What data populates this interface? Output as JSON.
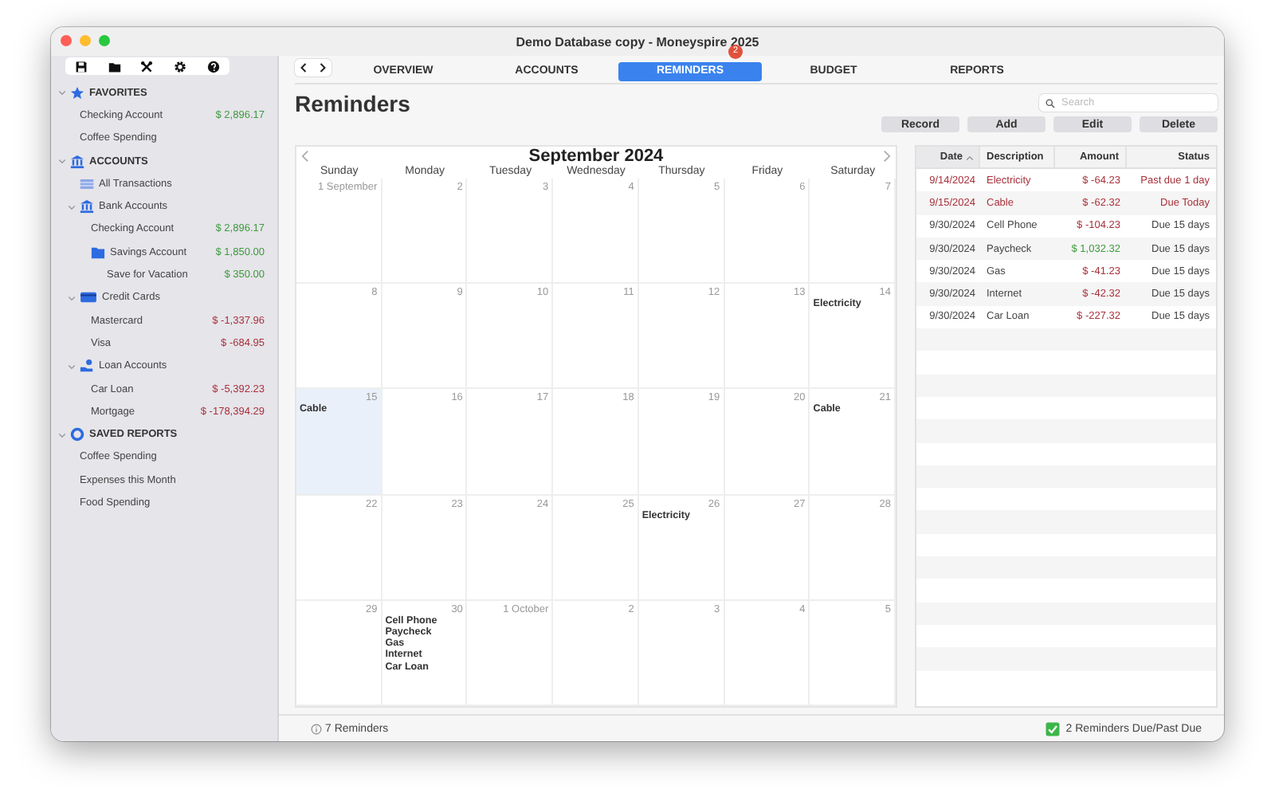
{
  "window": {
    "title": "Demo Database copy - Moneyspire 2025"
  },
  "sidebar": {
    "sections": [
      {
        "title": "FAVORITES",
        "kind": "favorites",
        "expanded": true,
        "items": [
          {
            "label": "Checking Account",
            "amount": "$ 2,896.17",
            "negative": false
          },
          {
            "label": "Coffee Spending"
          }
        ]
      },
      {
        "title": "ACCOUNTS",
        "kind": "accounts",
        "expanded": true,
        "items": [
          {
            "label": "All Transactions",
            "kind": "list"
          },
          {
            "label": "Bank Accounts",
            "kind": "bank",
            "expanded": true,
            "children": [
              {
                "label": "Checking Account",
                "amount": "$ 2,896.17",
                "negative": false
              },
              {
                "label": "Savings Account",
                "kind": "folder",
                "amount": "$ 1,850.00",
                "negative": false,
                "children": [
                  {
                    "label": "Save for Vacation",
                    "amount": "$ 350.00",
                    "negative": false
                  }
                ]
              }
            ]
          },
          {
            "label": "Credit Cards",
            "kind": "card",
            "expanded": true,
            "children": [
              {
                "label": "Mastercard",
                "amount": "$ -1,337.96",
                "negative": true
              },
              {
                "label": "Visa",
                "amount": "$ -684.95",
                "negative": true
              }
            ]
          },
          {
            "label": "Loan Accounts",
            "kind": "loan",
            "expanded": true,
            "children": [
              {
                "label": "Car Loan",
                "amount": "$ -5,392.23",
                "negative": true
              },
              {
                "label": "Mortgage",
                "amount": "$ -178,394.29",
                "negative": true
              }
            ]
          }
        ]
      },
      {
        "title": "SAVED REPORTS",
        "kind": "reports",
        "expanded": true,
        "items": [
          {
            "label": "Coffee Spending"
          },
          {
            "label": "Expenses this Month"
          },
          {
            "label": "Food Spending"
          }
        ]
      }
    ]
  },
  "tabs": [
    {
      "label": "OVERVIEW",
      "selected": false
    },
    {
      "label": "ACCOUNTS",
      "selected": false
    },
    {
      "label": "REMINDERS",
      "selected": true,
      "badge": "2"
    },
    {
      "label": "BUDGET",
      "selected": false
    },
    {
      "label": "REPORTS",
      "selected": false
    }
  ],
  "page_title": "Reminders",
  "search": {
    "placeholder": "Search"
  },
  "buttons": [
    "Record",
    "Add",
    "Edit",
    "Delete"
  ],
  "calendar": {
    "title": "September 2024",
    "weekdays": [
      "Sunday",
      "Monday",
      "Tuesday",
      "Wednesday",
      "Thursday",
      "Friday",
      "Saturday"
    ],
    "weeks": [
      [
        {
          "day": "1 September",
          "selected": false
        },
        {
          "day": "2",
          "selected": false
        },
        {
          "day": "3",
          "selected": false
        },
        {
          "day": "4",
          "selected": false
        },
        {
          "day": "5",
          "selected": false
        },
        {
          "day": "6",
          "selected": false
        },
        {
          "day": "7",
          "selected": false
        }
      ],
      [
        {
          "day": "8",
          "selected": false
        },
        {
          "day": "9",
          "selected": false
        },
        {
          "day": "10",
          "selected": false
        },
        {
          "day": "11",
          "selected": false
        },
        {
          "day": "12",
          "selected": false
        },
        {
          "day": "13",
          "selected": false
        },
        {
          "day": "14",
          "selected": false,
          "events": [
            "Electricity"
          ]
        }
      ],
      [
        {
          "day": "15",
          "selected": true,
          "events": [
            "Cable"
          ]
        },
        {
          "day": "16",
          "selected": false
        },
        {
          "day": "17",
          "selected": false
        },
        {
          "day": "18",
          "selected": false
        },
        {
          "day": "19",
          "selected": false
        },
        {
          "day": "20",
          "selected": false
        },
        {
          "day": "21",
          "selected": false,
          "events": [
            "Cable"
          ]
        }
      ],
      [
        {
          "day": "22",
          "selected": false
        },
        {
          "day": "23",
          "selected": false
        },
        {
          "day": "24",
          "selected": false
        },
        {
          "day": "25",
          "selected": false
        },
        {
          "day": "26",
          "selected": false,
          "events": [
            "Electricity"
          ]
        },
        {
          "day": "27",
          "selected": false
        },
        {
          "day": "28",
          "selected": false
        }
      ],
      [
        {
          "day": "29",
          "selected": false
        },
        {
          "day": "30",
          "selected": false,
          "events": [
            "Cell Phone",
            "Paycheck",
            "Gas",
            "Internet",
            "Car Loan"
          ]
        },
        {
          "day": "1 October",
          "selected": false
        },
        {
          "day": "2",
          "selected": false
        },
        {
          "day": "3",
          "selected": false
        },
        {
          "day": "4",
          "selected": false
        },
        {
          "day": "5",
          "selected": false
        }
      ]
    ]
  },
  "table": {
    "columns": [
      {
        "label": "Date",
        "sorted": true
      },
      {
        "label": "Description",
        "sorted": false
      },
      {
        "label": "Amount",
        "sorted": false
      },
      {
        "label": "Status",
        "sorted": false
      }
    ],
    "rows": [
      {
        "date": "9/14/2024",
        "description": "Electricity",
        "amount": "$ -64.23",
        "status": "Past due 1 day",
        "overdue": true,
        "negative": true
      },
      {
        "date": "9/15/2024",
        "description": "Cable",
        "amount": "$ -62.32",
        "status": "Due Today",
        "overdue": true,
        "negative": true
      },
      {
        "date": "9/30/2024",
        "description": "Cell Phone",
        "amount": "$ -104.23",
        "status": "Due 15 days",
        "overdue": false,
        "negative": true
      },
      {
        "date": "9/30/2024",
        "description": "Paycheck",
        "amount": "$ 1,032.32",
        "status": "Due 15 days",
        "overdue": false,
        "negative": false
      },
      {
        "date": "9/30/2024",
        "description": "Gas",
        "amount": "$ -41.23",
        "status": "Due 15 days",
        "overdue": false,
        "negative": true
      },
      {
        "date": "9/30/2024",
        "description": "Internet",
        "amount": "$ -42.32",
        "status": "Due 15 days",
        "overdue": false,
        "negative": true
      },
      {
        "date": "9/30/2024",
        "description": "Car Loan",
        "amount": "$ -227.32",
        "status": "Due 15 days",
        "overdue": false,
        "negative": true
      }
    ]
  },
  "status_bar": {
    "left": "7 Reminders",
    "right": "2 Reminders Due/Past Due"
  }
}
